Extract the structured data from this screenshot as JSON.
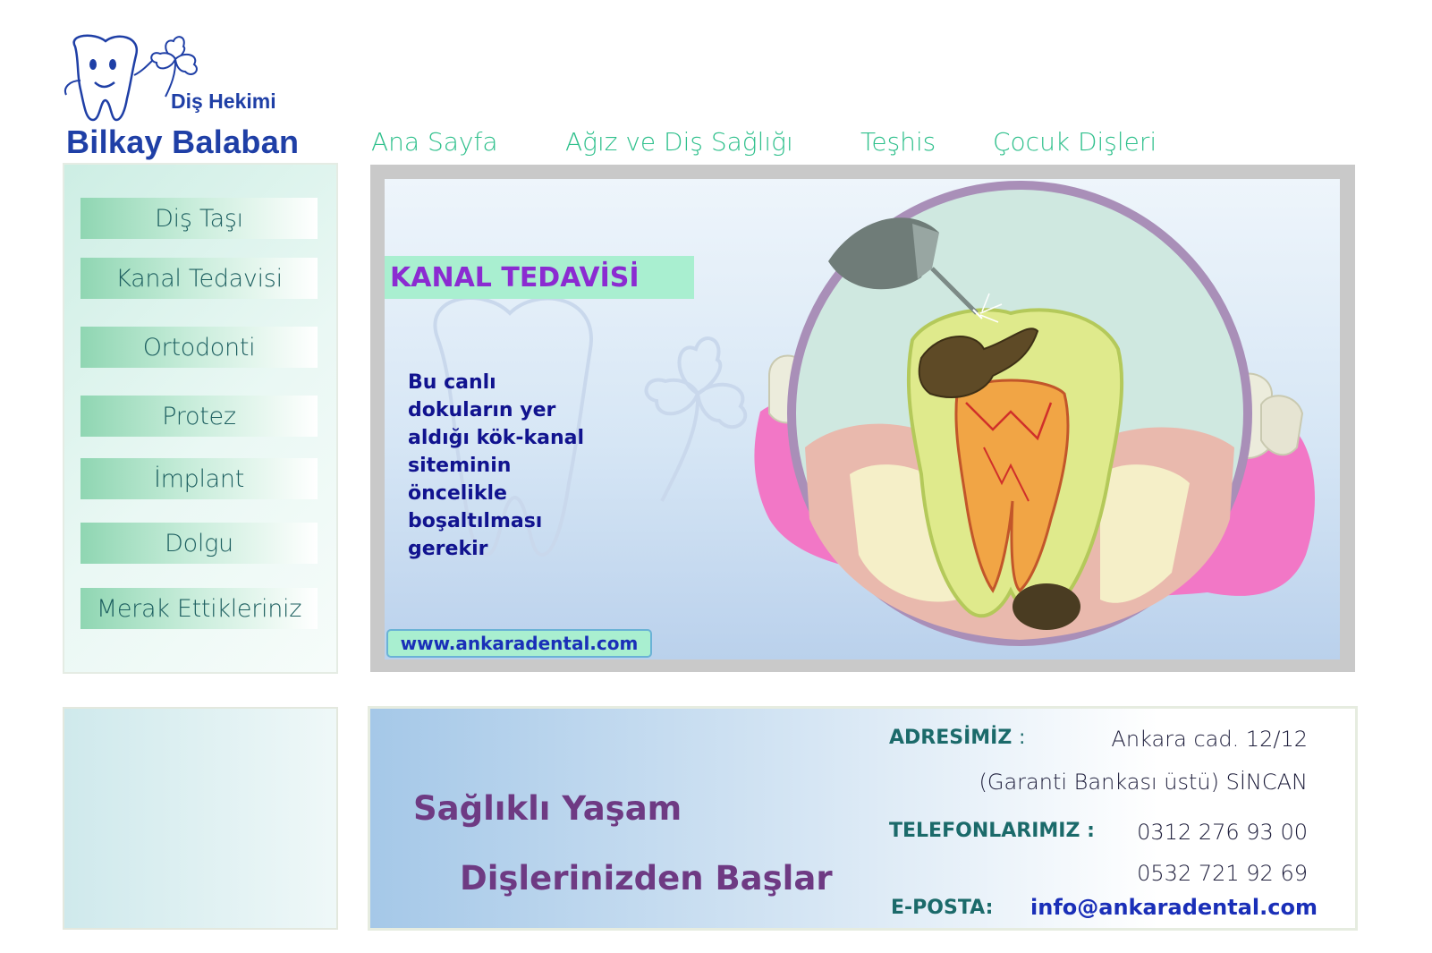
{
  "logo": {
    "subtitle": "Diş Hekimi",
    "name": "Bilkay Balaban"
  },
  "topnav": {
    "items": [
      "Ana Sayfa",
      "Ağız ve Diş Sağlığı",
      "Teşhis",
      "Çocuk Dişleri"
    ]
  },
  "sidebar": {
    "items": [
      "Diş Taşı",
      "Kanal Tedavisi",
      "Ortodonti",
      "Protez",
      "İmplant",
      "Dolgu",
      "Merak Ettikleriniz"
    ]
  },
  "banner": {
    "title": "KANAL TEDAVİSİ",
    "text_lines": [
      "Bu canlı",
      "dokuların yer",
      "aldığı kök-kanal",
      "siteminin",
      "öncelikle",
      "boşaltılması",
      "gerekir"
    ],
    "url": "www.ankaradental.com"
  },
  "footer": {
    "slogan_line1": "Sağlıklı Yaşam",
    "slogan_line2": "Dişlerinizden Başlar",
    "address_label": "ADRESİMİZ",
    "address_colon": ":",
    "address_line1": "Ankara cad. 12/12",
    "address_line2": "(Garanti Bankası üstü) SİNCAN",
    "phone_label": "TELEFONLARIMIZ :",
    "phone1": "0312 276 93 00",
    "phone2": "0532 721 92 69",
    "email_label": "E-POSTA:",
    "email": "info@ankaradental.com"
  },
  "colors": {
    "logo_blue": "#1f3fa6",
    "nav_green": "#2fc08c",
    "sidebar_text": "#1d5f60",
    "banner_title_bg": "#a9efd0",
    "banner_title_text": "#8b2bd1",
    "slogan_purple": "#6e3a83"
  },
  "icons": [
    "tooth-mascot-icon",
    "clover-icon"
  ]
}
